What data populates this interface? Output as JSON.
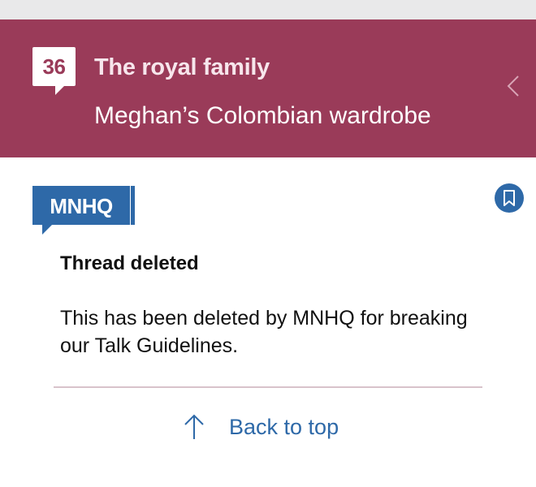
{
  "header": {
    "post_count": "36",
    "topic": "The royal family",
    "thread_title": "Meghan’s Colombian wardrobe",
    "back_icon": "chevron-left-icon"
  },
  "notice": {
    "badge_label": "MNHQ",
    "bookmark_icon": "bookmark-icon",
    "heading": "Thread deleted",
    "body": "This has been deleted by MNHQ for breaking our Talk Guidelines."
  },
  "footer": {
    "back_to_top_label": "Back to top",
    "arrow_icon": "arrow-up-icon"
  },
  "colors": {
    "header_bg": "#9a3b59",
    "accent_blue": "#2e69a8",
    "status_strip": "#e9e9ea"
  }
}
